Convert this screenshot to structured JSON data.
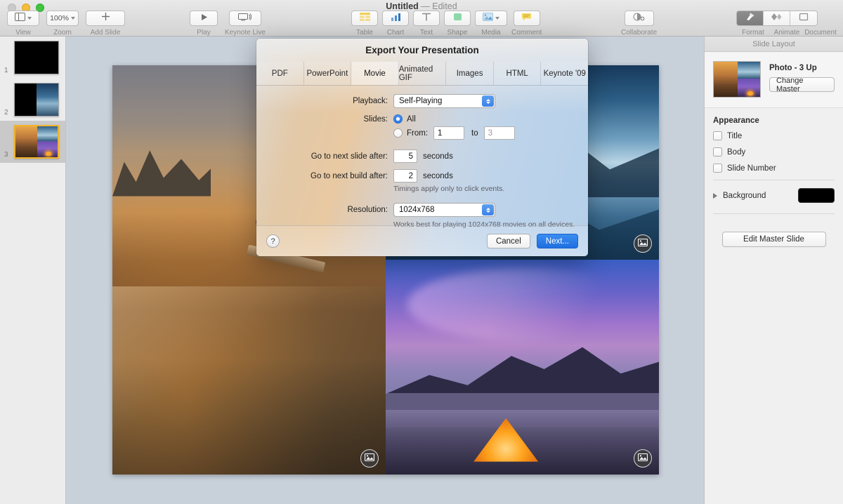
{
  "window": {
    "title": "Untitled",
    "status": "— Edited",
    "traffic": [
      "close-button",
      "minimize-button",
      "zoom-button"
    ]
  },
  "toolbar": {
    "left": [
      {
        "label": "View",
        "icon": "view-panel-icon",
        "has_caret": true
      },
      {
        "label": "Zoom",
        "icon": "zoom-level",
        "value": "100%",
        "has_caret": true
      },
      {
        "label": "Add Slide",
        "icon": "plus-icon",
        "has_caret": false
      }
    ],
    "play_group": [
      {
        "label": "Play",
        "icon": "play-triangle-icon"
      },
      {
        "label": "Keynote Live",
        "icon": "display-broadcast-icon"
      }
    ],
    "insert": [
      {
        "label": "Table",
        "icon": "table-icon"
      },
      {
        "label": "Chart",
        "icon": "bar-chart-icon"
      },
      {
        "label": "Text",
        "icon": "text-t-icon"
      },
      {
        "label": "Shape",
        "icon": "shape-square-icon"
      },
      {
        "label": "Media",
        "icon": "media-image-icon",
        "has_caret": true
      },
      {
        "label": "Comment",
        "icon": "comment-icon"
      }
    ],
    "collaborate": {
      "label": "Collaborate",
      "icon": "collaborate-person-icon"
    },
    "right_segments": [
      {
        "label": "Format",
        "icon": "format-brush-icon",
        "selected": true
      },
      {
        "label": "Animate",
        "icon": "animate-diamond-icon",
        "selected": false
      },
      {
        "label": "Document",
        "icon": "document-rect-icon",
        "selected": false
      }
    ]
  },
  "navigator": {
    "slides": [
      {
        "number": "1",
        "art": "black",
        "selected": false
      },
      {
        "number": "2",
        "art": "half-blue",
        "selected": false
      },
      {
        "number": "3",
        "art": "photo-3up",
        "selected": true
      }
    ]
  },
  "canvas": {
    "placeholders": [
      {
        "name": "image-placeholder-badge",
        "icon": "image-placeholder-icon"
      },
      {
        "name": "image-placeholder-badge",
        "icon": "image-placeholder-icon"
      },
      {
        "name": "image-placeholder-badge",
        "icon": "image-placeholder-icon"
      }
    ]
  },
  "inspector": {
    "title": "Slide Layout",
    "master": {
      "name": "Photo - 3 Up",
      "change_button": "Change Master"
    },
    "appearance": {
      "heading": "Appearance",
      "options": [
        {
          "label": "Title",
          "checked": false
        },
        {
          "label": "Body",
          "checked": false
        },
        {
          "label": "Slide Number",
          "checked": false
        }
      ]
    },
    "background": {
      "label": "Background",
      "color": "#000000"
    },
    "edit_master_button": "Edit Master Slide"
  },
  "dialog": {
    "title": "Export Your Presentation",
    "tabs": [
      {
        "label": "PDF",
        "active": false
      },
      {
        "label": "PowerPoint",
        "active": false
      },
      {
        "label": "Movie",
        "active": true
      },
      {
        "label": "Animated GIF",
        "active": false
      },
      {
        "label": "Images",
        "active": false
      },
      {
        "label": "HTML",
        "active": false
      },
      {
        "label": "Keynote '09",
        "active": false
      }
    ],
    "playback": {
      "label": "Playback:",
      "value": "Self-Playing"
    },
    "slides": {
      "label": "Slides:",
      "all_label": "All",
      "all_selected": true,
      "from_label": "From:",
      "from_value": "1",
      "to_label": "to",
      "to_value": "3"
    },
    "next_slide": {
      "label": "Go to next slide after:",
      "value": "5",
      "unit": "seconds"
    },
    "next_build": {
      "label": "Go to next build after:",
      "value": "2",
      "unit": "seconds"
    },
    "timings_note": "Timings apply only to click events.",
    "resolution": {
      "label": "Resolution:",
      "value": "1024x768",
      "note": "Works best for playing 1024x768 movies on all devices."
    },
    "help_glyph": "?",
    "cancel_label": "Cancel",
    "next_label": "Next...",
    "accent_color": "#1f6fe0"
  }
}
